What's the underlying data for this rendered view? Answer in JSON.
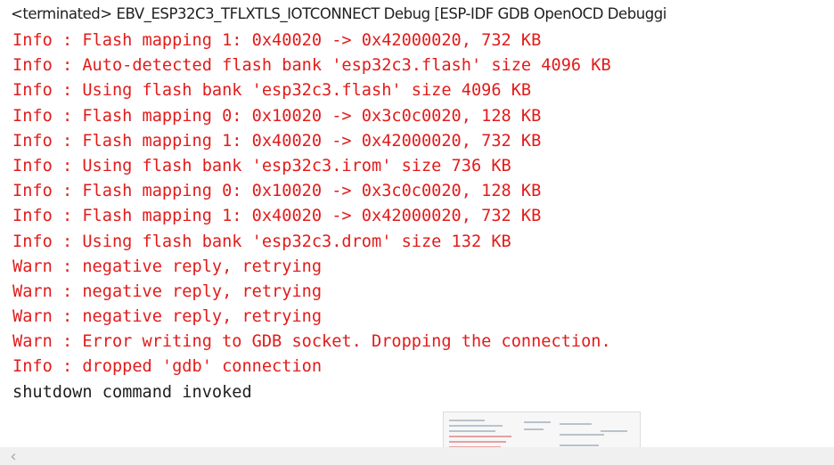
{
  "console": {
    "title": "<terminated> EBV_ESP32C3_TFLXTLS_IOTCONNECT Debug [ESP-IDF GDB OpenOCD Debuggi",
    "lines": [
      {
        "text": "Info : Flash mapping 1: 0x40020 -> 0x42000020, 732 KB",
        "style": "err"
      },
      {
        "text": "Info : Auto-detected flash bank 'esp32c3.flash' size 4096 KB",
        "style": "err"
      },
      {
        "text": "Info : Using flash bank 'esp32c3.flash' size 4096 KB",
        "style": "err"
      },
      {
        "text": "Info : Flash mapping 0: 0x10020 -> 0x3c0c0020, 128 KB",
        "style": "err"
      },
      {
        "text": "Info : Flash mapping 1: 0x40020 -> 0x42000020, 732 KB",
        "style": "err"
      },
      {
        "text": "Info : Using flash bank 'esp32c3.irom' size 736 KB",
        "style": "err"
      },
      {
        "text": "Info : Flash mapping 0: 0x10020 -> 0x3c0c0020, 128 KB",
        "style": "err"
      },
      {
        "text": "Info : Flash mapping 1: 0x40020 -> 0x42000020, 732 KB",
        "style": "err"
      },
      {
        "text": "Info : Using flash bank 'esp32c3.drom' size 132 KB",
        "style": "err"
      },
      {
        "text": "Warn : negative reply, retrying",
        "style": "err"
      },
      {
        "text": "Warn : negative reply, retrying",
        "style": "err"
      },
      {
        "text": "Warn : negative reply, retrying",
        "style": "err"
      },
      {
        "text": "Warn : Error writing to GDB socket. Dropping the connection.",
        "style": "err"
      },
      {
        "text": "Info : dropped 'gdb' connection",
        "style": "err"
      },
      {
        "text": "shutdown command invoked",
        "style": "out"
      }
    ],
    "error_color": "#e21b1b",
    "output_color": "#1f1f1f"
  },
  "scrollbar": {
    "left_icon": "chevron-left-icon",
    "left_glyph": "‹"
  }
}
